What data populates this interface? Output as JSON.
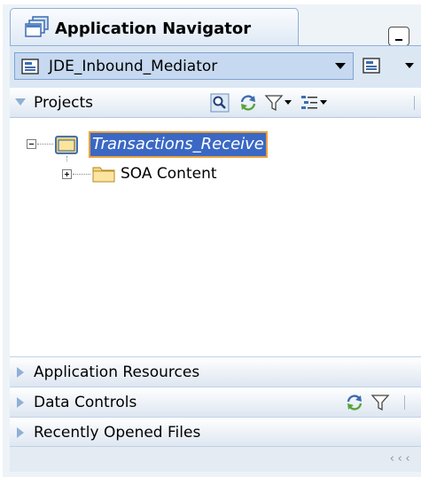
{
  "panel": {
    "title": "Application Navigator"
  },
  "application": {
    "selected": "JDE_Inbound_Mediator"
  },
  "projects": {
    "label": "Projects",
    "tree": {
      "root_label": "Transactions_Receive",
      "child_label": "SOA Content"
    }
  },
  "accordion": {
    "application_resources": "Application Resources",
    "data_controls": "Data Controls",
    "recently_opened_files": "Recently Opened Files"
  },
  "status": {
    "scroll_chevrons": "‹‹‹"
  },
  "icons": {
    "panel": "application-navigator-icon",
    "app": "application-icon",
    "project": "project-folder-icon",
    "folder": "folder-icon",
    "find": "find-icon",
    "refresh": "refresh-icon",
    "filter": "filter-icon",
    "view": "view-options-icon"
  },
  "colors": {
    "selection_bg": "#3a68c4",
    "selection_outline": "#e8a13c",
    "panel_border": "#8eb0d6",
    "header_bg": "#dce7f4"
  }
}
